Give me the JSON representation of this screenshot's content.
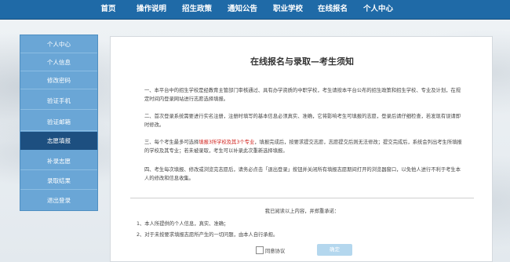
{
  "nav": {
    "items": [
      "首页",
      "操作说明",
      "招生政策",
      "通知公告",
      "职业学校",
      "在线报名",
      "个人中心"
    ]
  },
  "sidebar": {
    "items": [
      "个人中心",
      "个人信息",
      "修改密码",
      "验证手机",
      "验证邮箱",
      "志愿填报",
      "补录志愿",
      "录取结果",
      "退出登录"
    ],
    "active_index": 5
  },
  "notice": {
    "title": "在线报名与录取—考生须知",
    "p1": "一、本平台中的招生学校是经教育主管部门审核通过、具有办学资质的中职学校，考生请按本平台公布的招生政策和招生学校、专业及计划，在规定时间内登录网站进行志愿选择填报。",
    "p2": "二、首次登录系统需要进行实名注册，注册时填写的基本信息必须真实、准确，它将影响考生可填报的志愿，登录后请仔细检查，若发现有误请即时修改。",
    "p3_pre": "三、每个考生最多可选择",
    "p3_red": "填报3所学校及其3个专业",
    "p3_post": "，填报完成后，按要求提交志愿，志愿提交后则无法修改；提交完成后，系统会列出考生所填报的学校及其专业；若未被录取，考生可以补录此次重新选择填报。",
    "p4": "四、考生每次填报、修改或浏览完志愿后，请务必点击「退出登录」按钮并关闭所有填报志愿期间打开的浏览器窗口，以免他人进行不利于考生本人的修改和信息收集。"
  },
  "commitment": {
    "heading": "我已阅读以上内容，并郑重承诺：",
    "items": [
      "1、本人所提供的个人信息，真实、准确；",
      "2、对于未按要求填报志愿所产生的一切问题，由本人自行承担。"
    ],
    "agree_label": "同意协议",
    "confirm_label": "确定"
  },
  "colors": {
    "nav_bg": "#1f6aa7",
    "sidebar_bg": "#6aa6d6",
    "sidebar_active": "#1d4f80",
    "highlight_red": "#d0201b",
    "button_disabled": "#b4d7ee"
  }
}
